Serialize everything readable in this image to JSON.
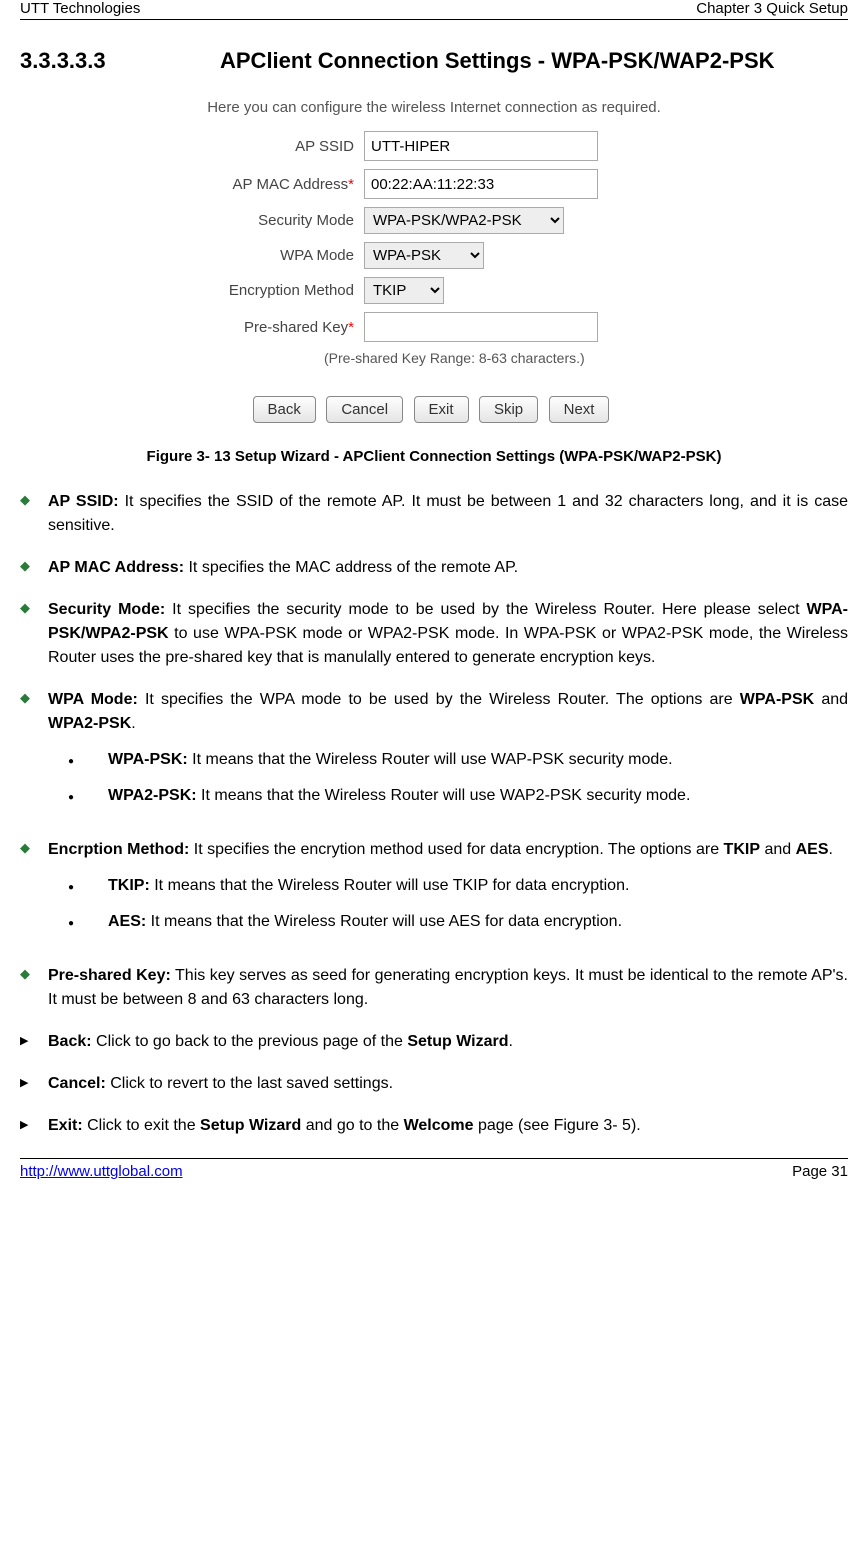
{
  "header": {
    "left": "UTT Technologies",
    "right": "Chapter 3 Quick Setup"
  },
  "section": {
    "number": "3.3.3.3.3",
    "title": "APClient Connection Settings - WPA-PSK/WAP2-PSK"
  },
  "form": {
    "intro": "Here you can configure the wireless Internet connection as required.",
    "labels": {
      "ssid": "AP SSID",
      "mac": "AP MAC Address",
      "security": "Security Mode",
      "wpa": "WPA Mode",
      "enc": "Encryption Method",
      "psk": "Pre-shared Key"
    },
    "values": {
      "ssid": "UTT-HIPER",
      "mac": "00:22:AA:11:22:33",
      "security": "WPA-PSK/WPA2-PSK",
      "wpa": "WPA-PSK",
      "enc": "TKIP",
      "psk": ""
    },
    "hint": "(Pre-shared Key Range: 8-63 characters.)",
    "buttons": {
      "back": "Back",
      "cancel": "Cancel",
      "exit": "Exit",
      "skip": "Skip",
      "next": "Next"
    }
  },
  "figure_caption": "Figure 3- 13 Setup Wizard - APClient Connection Settings (WPA-PSK/WAP2-PSK)",
  "bullets": {
    "ssid": {
      "label": "AP SSID:",
      "text": " It specifies the SSID of the remote AP. It must be between 1 and 32 characters long, and it is case sensitive."
    },
    "mac": {
      "label": "AP MAC Address:",
      "text": " It specifies the MAC address of the remote AP."
    },
    "security": {
      "label": "Security Mode:",
      "text_pre": " It specifies the security mode to be used by the Wireless Router. Here please select ",
      "bold1": "WPA-PSK/WPA2-PSK",
      "text_post": " to use WPA-PSK mode or WPA2-PSK mode. In WPA-PSK or WPA2-PSK mode, the Wireless Router uses the pre-shared key that is manulally entered to generate encryption keys."
    },
    "wpa": {
      "label": "WPA Mode:",
      "text_pre": " It specifies the WPA mode to be used by the Wireless Router. The options are ",
      "bold1": "WPA-PSK",
      "mid": " and ",
      "bold2": "WPA2-PSK",
      "text_post": "."
    },
    "wpa_sub1": {
      "label": "WPA-PSK:",
      "text": " It means that the Wireless Router will use WAP-PSK security mode."
    },
    "wpa_sub2": {
      "label": "WPA2-PSK:",
      "text": " It means that the Wireless Router will use WAP2-PSK security mode."
    },
    "enc": {
      "label": "Encrption Method:",
      "text_pre": " It specifies the encrytion method used for data encryption. The options are ",
      "bold1": "TKIP",
      "mid": " and ",
      "bold2": "AES",
      "text_post": "."
    },
    "enc_sub1": {
      "label": "TKIP:",
      "text": " It means that the Wireless Router will use TKIP for data encryption."
    },
    "enc_sub2": {
      "label": "AES:",
      "text": " It means that the Wireless Router will use AES for data encryption."
    },
    "psk": {
      "label": "Pre-shared Key:",
      "text": " This key serves as seed for generating encryption keys. It must be identical to the remote AP's. It must be between 8 and 63 characters long."
    },
    "back": {
      "label": "Back:",
      "text_pre": " Click to go back to the previous page of the ",
      "bold1": "Setup Wizard",
      "text_post": "."
    },
    "cancel": {
      "label": "Cancel:",
      "text": " Click to revert to the last saved settings."
    },
    "exit": {
      "label": "Exit:",
      "text_pre": " Click to exit the ",
      "bold1": "Setup Wizard",
      "mid": " and go to the ",
      "bold2": "Welcome",
      "text_post": " page (see Figure 3- 5)."
    }
  },
  "footer": {
    "url": "http://www.uttglobal.com",
    "page": "Page 31"
  }
}
